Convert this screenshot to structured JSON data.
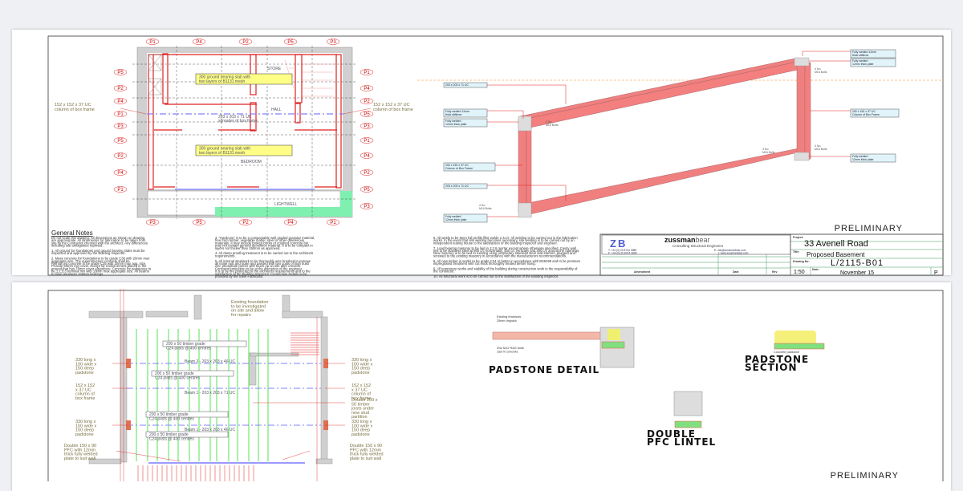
{
  "sheet1": {
    "plan": {
      "top_labels": [
        "P1",
        "P4",
        "P2",
        "P5",
        "P3"
      ],
      "left_labels": [
        "P5",
        "P2",
        "P4",
        "P1",
        "P3",
        "P5",
        "P2",
        "P4",
        "P1"
      ],
      "right_labels": [
        "P1",
        "P4",
        "P2",
        "P5",
        "P3",
        "P1",
        "P4",
        "P2",
        "P5",
        "P3"
      ],
      "bottom_labels": [
        "P3",
        "P5",
        "P2",
        "P4",
        "P1"
      ],
      "slab_note_1": [
        "300 ground bearing slab with",
        "two layers of B1131 mesh"
      ],
      "slab_note_2": [
        "300 ground bearing slab with",
        "two layers of B1131 mesh"
      ],
      "spreader": [
        "203 x 203 x 71 UC",
        "spreader of box frame"
      ],
      "column_left": [
        "152 x 152 x 37 UC",
        "column of box frame"
      ],
      "column_right": [
        "152 x 152 x 37 UC",
        "column of box frame"
      ],
      "room_store": "STORE",
      "room_main": "BEDROOM",
      "room_wc": "LIGHTWELL",
      "room_hall": "HALL"
    },
    "frame": {
      "top_beam": "203 x 203 x 71 UC",
      "bottom_beam": "203 x 203 x 71 UC",
      "stiffener_left": [
        "Fully welded 12mm",
        "thick stiffener"
      ],
      "plate_left_top": [
        "Fully welded",
        "12mm thick plate"
      ],
      "column_left": [
        "152 x 152 x 37 UC",
        "Column of Box Frame"
      ],
      "plate_left_bottom": [
        "Fully welded",
        "12mm thick plate"
      ],
      "stiffener_right": [
        "Fully welded 12mm",
        "thick stiffener"
      ],
      "plate_right_top": [
        "Fully welded",
        "12mm thick plate"
      ],
      "column_right": [
        "152 x 152 x 37 UC",
        "Column of Box Frame"
      ],
      "plate_right_bottom": [
        "Fully welded",
        "12mm thick plate"
      ],
      "bolts": [
        "4 No.",
        "M16 Bolts"
      ]
    },
    "preliminary": "PRELIMINARY",
    "notes": {
      "heading": "General Notes",
      "col1": [
        "Do not scale this drawing. All dimensions as shown on drawing",
        "are approximate. All dimensions for fabrication to be taken from",
        "site by the Contractor checked with the architect. Any differences",
        "including site ambiguities reported.",
        "",
        "1. All ground for foundations and ground bearing slabs must be",
        "inspected and approved by the Building Inspector.",
        "",
        "2. Mass concrete for foundations to be grade C30 with 20mm max",
        "aggregate size. The superstructure concrete shall be",
        "Reinforced concrete to be grade C35 with 20mm max agg. size.",
        "Provide 50mm min cover, except for reinforcement placed in the",
        "ground that has 75mm cover elsewhere. Concrete for padstones to",
        "be 1:1.5:3 nominal mix with 10mm max aggregate size. All beams",
        "to have minimum 150mm bearings."
      ],
      "col2": [
        "3. \"Hardcore\" is to be a compactable well graded granular material,",
        "free from timber, vegetable matter, steel or other deleterious",
        "materials. It may include broken bricks or crushed concrete but",
        "may not contain general demolition material. It is to be compact in",
        "layers not thicker than 150mm as approved.",
        "",
        "4. All damp proofing treatment is to be carried out to the architects",
        "requirements.",
        "",
        "5. All internal steelwork to be thoroughly wire brushed to remove",
        "all loose rust and scale and painted with two coats of high build",
        "zinc phosphate primer with touch up on site after erection.",
        "Corrosion protection to be at the discretion of the engineer.",
        "It is to be fire protected to the architects requirements and to the",
        "satisfaction of the Building Inspector. Connection Details to be",
        "provided by the Steel Fabricator."
      ],
      "col3": [
        "6. All welds to be 6mm full profile fillet welds U.N.O. All welding to be carried out in the fabrication",
        "works. In the event that site welding becomes necessary, site welding is to be carried out by an",
        "independent testing house to the satisfaction of the building inspector and engineer.",
        "",
        "7. Load bearing masonry to be laid in 1:1:6 mortar except where otherwise specified. Cavity wall",
        "ties to be stainless steel at 900 c/c horizontally, 450 c/c vertically and 300 c/c around the openings.",
        "New masonry is to be tied to existing using proprietary stainless steel wall starters, plugged and",
        "screwed to the existing masonry in accordance with the manufacturers recommendations.",
        "",
        "8. All new timber in works to be grade C24 or better in accordance with BS5268 and to be pressure",
        "impregnated treatment with cut ends thoroughly treated before fixing.",
        "",
        "9. All temporary works and stability of the building during construction work is the responsibility of",
        "the contractor.",
        "",
        "10. All structural work is to be carried out to the satisfaction of the Building Inspector."
      ]
    },
    "title_block": {
      "logo_mark": "ZB",
      "company_bold": "zussman",
      "company_light": "bear",
      "tagline": "Consulting Structural Engineers",
      "tel": "T: +44 (0) 20 8744 3988",
      "fax": "F: +44 (0) 20 8744 3999",
      "email": "E: info@zussmanbear.com",
      "web": "I: www.zussmanbear.com",
      "amendment_header": "Amendment",
      "date_header": "Date",
      "rev_header": "Rev",
      "project_label": "Project:",
      "project": "33 Avenell Road",
      "title_label": "Title:",
      "title": "Proposed Basement",
      "drawing_no_label": "Drawing No:",
      "drawing_no": "L/2115-B01",
      "scale": "1:50",
      "date_label": "Date:",
      "date": "November 15",
      "rev": "P"
    }
  },
  "sheet2": {
    "existing_foundation": [
      "Existing foundation",
      "to be investigated",
      "on site and allow",
      "for repairs"
    ],
    "joists_1": [
      "200 x 50 timber grade",
      "C24 joists @ 400 centres"
    ],
    "joists_2": [
      "200 x 50 timber grade",
      "C24 joists @ 400 centres"
    ],
    "joists_3": [
      "200 x 50 timber grade",
      "C24 joists @ 400 centres"
    ],
    "joists_4": [
      "200 x 50 timber grade",
      "C24 joists @ 400 centres"
    ],
    "beam_2": "Beam 2 - 203 x 203 x 46 UC",
    "beam_1a": "Beam 1 - 203 x 203 x 71 UC",
    "beam_1b": "Beam 1 - 203 x 203 x 46 UC",
    "padstone_l1": [
      "330 long x",
      "100 wide x",
      "150 deep",
      "padstone"
    ],
    "padstone_r1": [
      "330 long x",
      "100 wide x",
      "150 deep",
      "padstone"
    ],
    "column_l": [
      "152 x 152",
      "x 37 UC",
      "column of",
      "box frame"
    ],
    "column_r": [
      "152 x 152",
      "x 37 UC",
      "column of",
      "box frame"
    ],
    "padstone_l2": [
      "330 long x",
      "100 wide x",
      "150 deep",
      "padstone"
    ],
    "padstone_r2": [
      "330 long x",
      "100 wide x",
      "150 deep",
      "padstone"
    ],
    "double_joists": [
      "Double 200 x",
      "50 timber",
      "joists under",
      "new stud",
      "partition"
    ],
    "pfc_l": [
      "Double 150 x 90",
      "PFC with 12mm",
      "thick fully welded",
      "plate to suit wall"
    ],
    "pfc_r": [
      "Double 150 x 90",
      "PFC with 12mm",
      "thick fully welded",
      "plate to suit wall"
    ],
    "pd_brickwork": "Existing brickwork",
    "pd_drypack": "25mm drypack",
    "pd_bolts": [
      "2No M12 RAG bolts",
      "cast in concrete"
    ],
    "padstone_detail": "PADSTONE DETAIL",
    "padstone_section": [
      "PADSTONE",
      "SECTION"
    ],
    "concrete_padstone": "Concrete padstone",
    "pfc_lintel": [
      "DOUBLE",
      "PFC LINTEL"
    ],
    "preliminary": "PRELIMINARY"
  },
  "colors": {
    "steel": "#f08080",
    "red": "#e02020",
    "beam": "#8080ff",
    "joist": "#40e040",
    "note_bg": "#ffff88"
  }
}
